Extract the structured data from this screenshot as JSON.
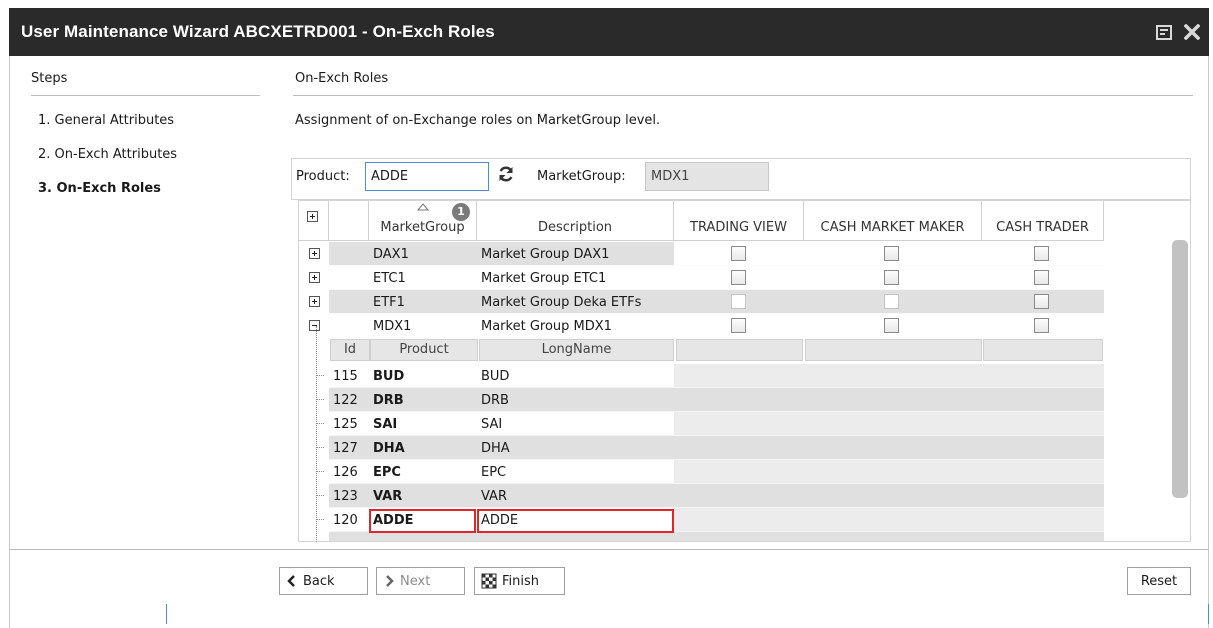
{
  "window": {
    "title": "User Maintenance Wizard ABCXETRD001 - On-Exch Roles",
    "restore_icon": "restore-window-icon",
    "close_icon": "close-icon"
  },
  "steps": {
    "title": "Steps",
    "items": [
      {
        "label": "1. General Attributes",
        "active": false
      },
      {
        "label": "2. On-Exch Attributes",
        "active": false
      },
      {
        "label": "3. On-Exch Roles",
        "active": true
      }
    ]
  },
  "section": {
    "title": "On-Exch Roles",
    "description": "Assignment of on-Exchange roles on MarketGroup level."
  },
  "filter": {
    "product_label": "Product:",
    "product_value": "ADDE",
    "refresh_icon": "refresh-icon",
    "marketgroup_label": "MarketGroup:",
    "marketgroup_value": "MDX1"
  },
  "grid": {
    "columns": {
      "marketgroup": "MarketGroup",
      "description": "Description",
      "trading_view": "TRADING VIEW",
      "cash_market_maker": "CASH MARKET MAKER",
      "cash_trader": "CASH TRADER"
    },
    "sort_badge": "1",
    "groups": [
      {
        "marketgroup": "DAX1",
        "description": "Market Group DAX1",
        "expanded": false,
        "trading_view": false,
        "cash_market_maker": false,
        "cash_trader": false
      },
      {
        "marketgroup": "ETC1",
        "description": "Market Group ETC1",
        "expanded": false,
        "trading_view": false,
        "cash_market_maker": false,
        "cash_trader": false
      },
      {
        "marketgroup": "ETF1",
        "description": "Market Group Deka ETFs",
        "expanded": false,
        "trading_view": false,
        "cash_market_maker": false,
        "cash_trader": false
      },
      {
        "marketgroup": "MDX1",
        "description": "Market Group MDX1",
        "expanded": true,
        "trading_view": false,
        "cash_market_maker": false,
        "cash_trader": false
      }
    ],
    "child_columns": {
      "id": "Id",
      "product": "Product",
      "longname": "LongName"
    },
    "children": [
      {
        "id": "115",
        "product": "BUD",
        "longname": "BUD"
      },
      {
        "id": "122",
        "product": "DRB",
        "longname": "DRB"
      },
      {
        "id": "125",
        "product": "SAI",
        "longname": "SAI"
      },
      {
        "id": "127",
        "product": "DHA",
        "longname": "DHA"
      },
      {
        "id": "126",
        "product": "EPC",
        "longname": "EPC"
      },
      {
        "id": "123",
        "product": "VAR",
        "longname": "VAR"
      },
      {
        "id": "120",
        "product": "ADDE",
        "longname": "ADDE",
        "highlighted": true
      }
    ]
  },
  "buttons": {
    "back": "Back",
    "next": "Next",
    "finish": "Finish",
    "reset": "Reset"
  },
  "colors": {
    "titlebar": "#2a2a2a",
    "highlight": "#e0262c",
    "focus": "#4a90d9"
  }
}
